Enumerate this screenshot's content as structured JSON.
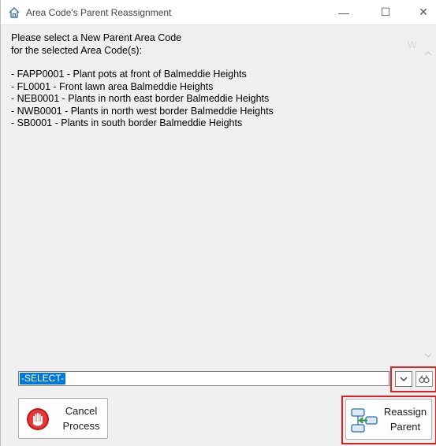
{
  "window": {
    "title": "Area Code's Parent Reassignment",
    "controls": {
      "minimize": "—",
      "maximize": "☐",
      "close": "✕"
    }
  },
  "message": {
    "line1": "Please select a New Parent Area Code",
    "line2": "for the selected Area Code(s):",
    "items": [
      "- FAPP0001 - Plant pots at front of Balmeddie Heights",
      "- FL0001 - Front lawn area Balmeddie Heights",
      "- NEB0001 - Plants in north east border Balmeddie Heights",
      "- NWB0001 - Plants in north west border Balmeddie Heights",
      "- SB0001 - Plants in south border Balmeddie Heights"
    ]
  },
  "background_fragment": "W",
  "parent_select": {
    "selected": "-SELECT-"
  },
  "buttons": {
    "cancel": {
      "line1": "Cancel",
      "line2": "Process"
    },
    "reassign": {
      "line1": "Reassign",
      "line2": "Parent"
    }
  },
  "icons": {
    "app": "area-code-icon",
    "dropdown": "chevron-down-icon",
    "lookup": "binoculars-icon",
    "cancel": "stop-hand-icon",
    "reassign": "reassign-parent-icon"
  },
  "colors": {
    "selection": "#0078d7",
    "highlight": "#e02020",
    "stop": "#d62828"
  }
}
